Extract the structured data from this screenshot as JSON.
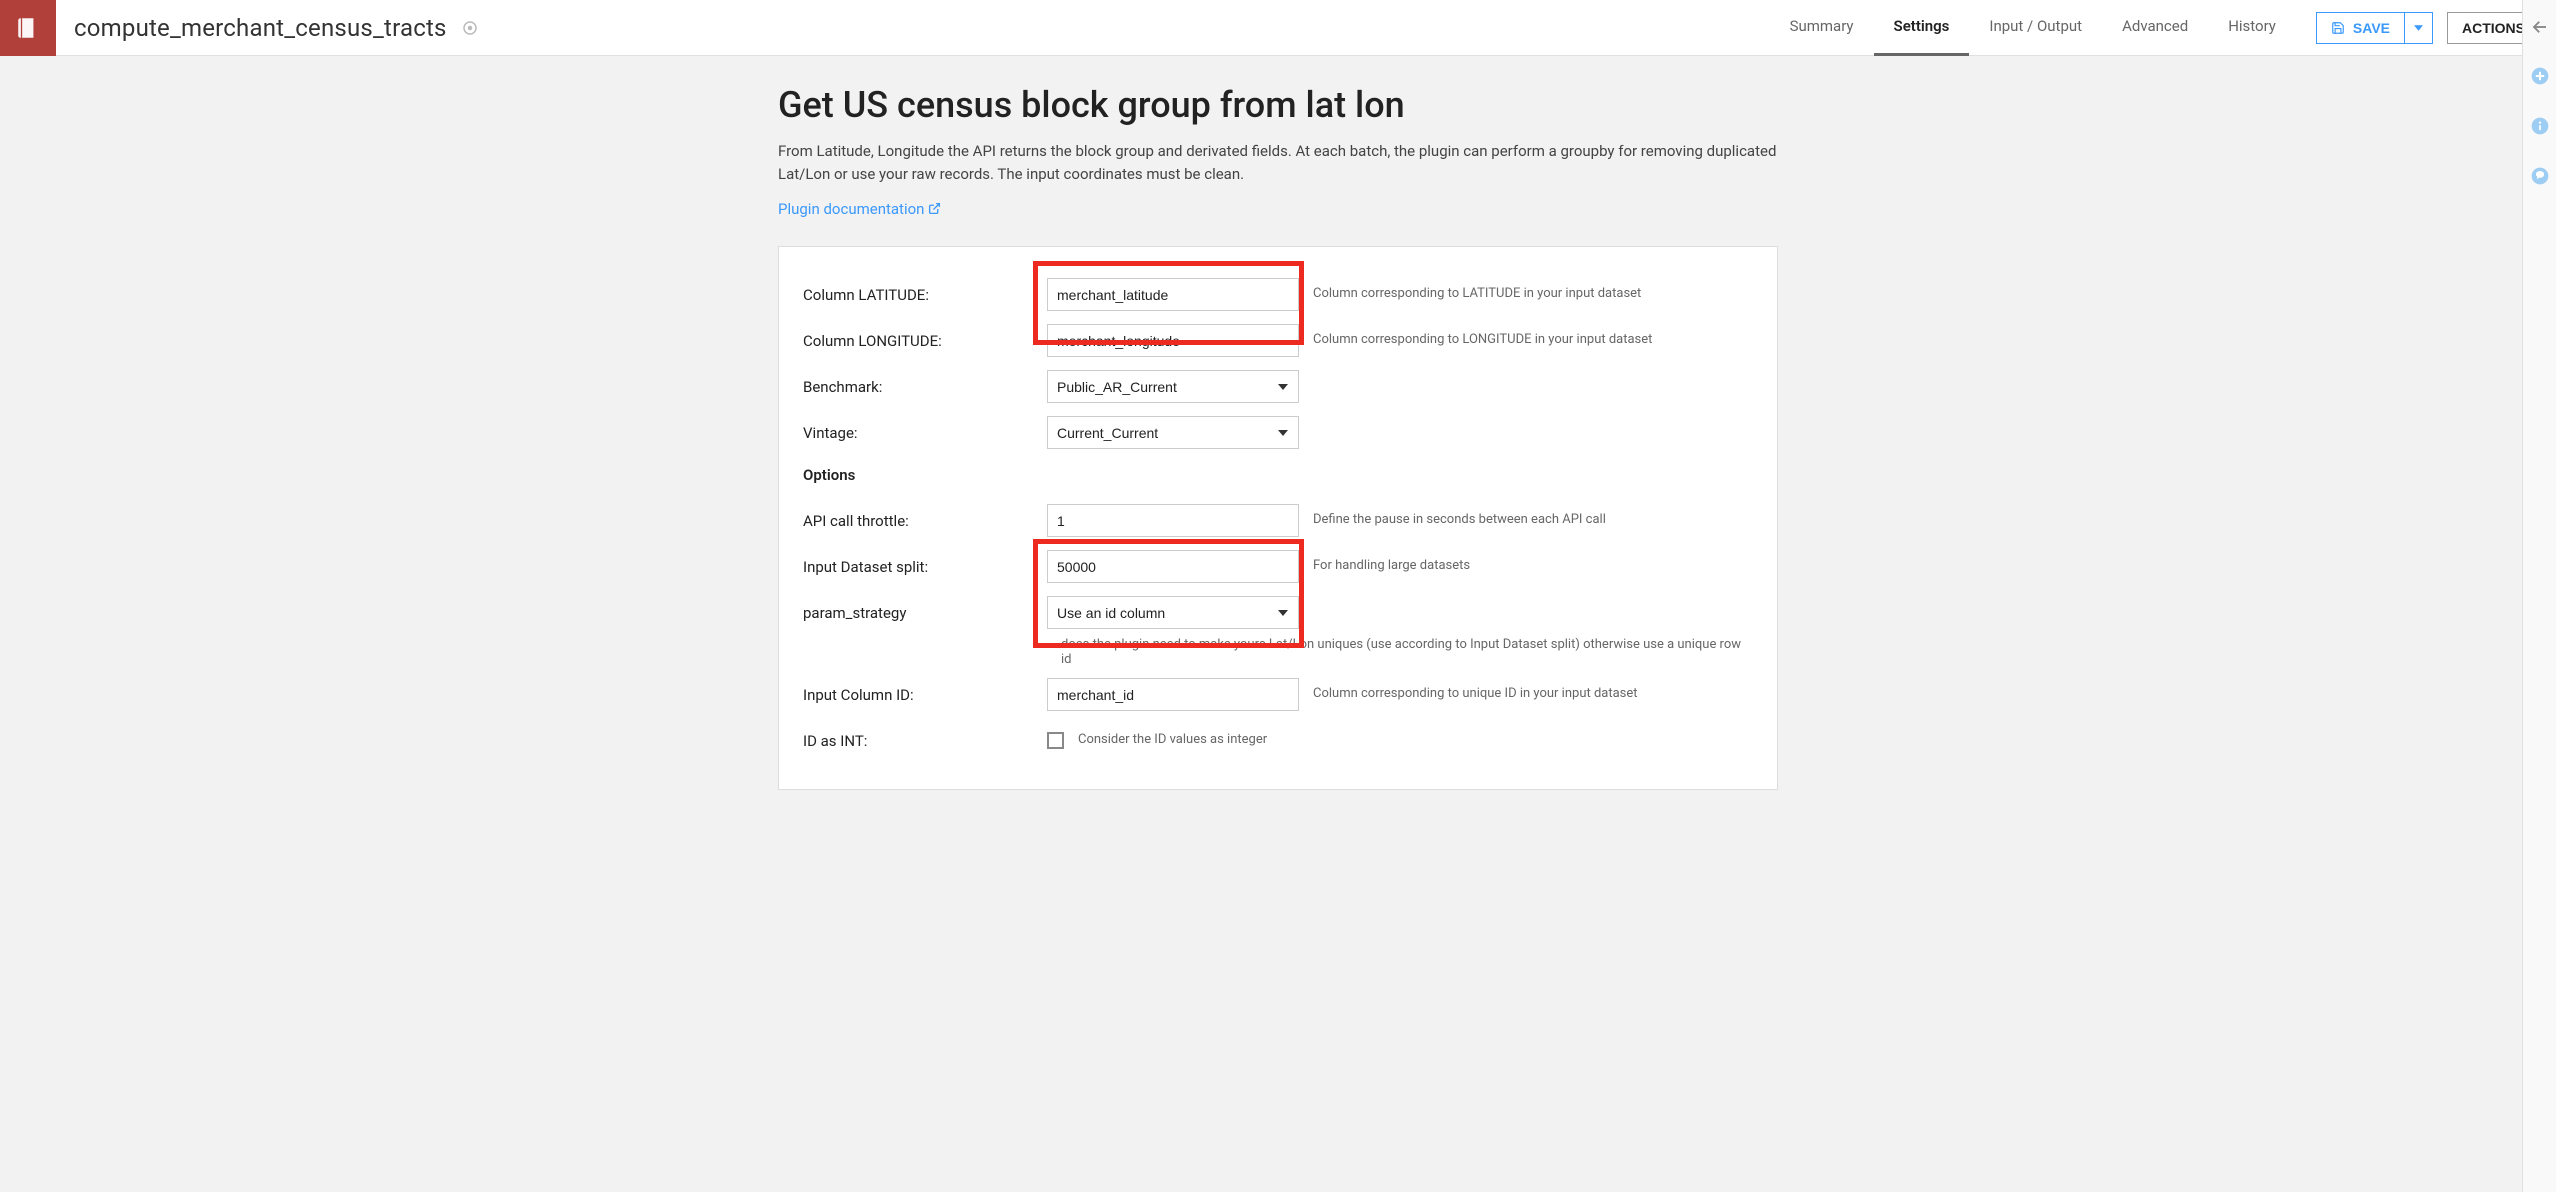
{
  "header": {
    "recipe_name": "compute_merchant_census_tracts",
    "tabs": [
      "Summary",
      "Settings",
      "Input / Output",
      "Advanced",
      "History"
    ],
    "active_tab": 1,
    "save_label": "SAVE",
    "actions_label": "ACTIONS"
  },
  "page": {
    "title": "Get US census block group from lat lon",
    "description": "From Latitude, Longitude the API returns the block group and derivated fields. At each batch, the plugin can perform a groupby for removing duplicated Lat/Lon or use your raw records. The input coordinates must be clean.",
    "doc_link_label": "Plugin documentation"
  },
  "form": {
    "latitude": {
      "label": "Column LATITUDE:",
      "value": "merchant_latitude",
      "hint": "Column corresponding to LATITUDE in your input dataset"
    },
    "longitude": {
      "label": "Column LONGITUDE:",
      "value": "merchant_longitude",
      "hint": "Column corresponding to LONGITUDE in your input dataset"
    },
    "benchmark": {
      "label": "Benchmark:",
      "value": "Public_AR_Current"
    },
    "vintage": {
      "label": "Vintage:",
      "value": "Current_Current"
    },
    "options_heading": "Options",
    "throttle": {
      "label": "API call throttle:",
      "value": "1",
      "hint": "Define the pause in seconds between each API call"
    },
    "split": {
      "label": "Input Dataset split:",
      "value": "50000",
      "hint": "For handling large datasets"
    },
    "param_strategy": {
      "label": "param_strategy",
      "value": "Use an id column",
      "long_hint": "does the plugin need to make yours Lat/Lon uniques (use according to Input Dataset split) otherwise use a unique row id"
    },
    "input_column_id": {
      "label": "Input Column ID:",
      "value": "merchant_id",
      "hint": "Column corresponding to unique ID in your input dataset"
    },
    "id_as_int": {
      "label": "ID as INT:",
      "chk_label": "Consider the ID values as integer"
    }
  }
}
